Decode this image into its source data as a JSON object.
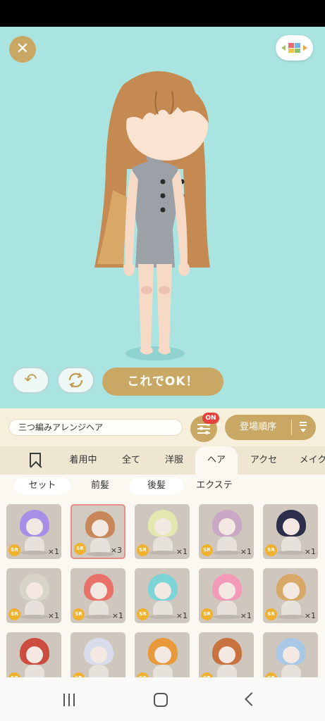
{
  "screen": {
    "ok_button": "これでOK！",
    "close_glyph": "✕",
    "undo_glyph": "↶"
  },
  "toolbar": {
    "item_name": "三つ編みアレンジヘア",
    "filter_badge": "ON",
    "sort_label": "登場順序"
  },
  "categories": [
    "着用中",
    "全て",
    "洋服",
    "ヘア",
    "アクセ",
    "メイク"
  ],
  "active_category": "ヘア",
  "subcategories": [
    "セット",
    "前髪",
    "後髪",
    "エクステ"
  ],
  "active_subcategory": "前髪",
  "items": [
    {
      "rarity": "SR",
      "qty": "×1",
      "color": "#a98ee8"
    },
    {
      "rarity": "SR",
      "qty": "×3",
      "color": "#c8875a",
      "selected": true
    },
    {
      "rarity": "SR",
      "qty": "×1",
      "color": "#e4e8b0"
    },
    {
      "rarity": "SR",
      "qty": "×1",
      "color": "#c9a8c6"
    },
    {
      "rarity": "SR",
      "qty": "×1",
      "color": "#2d2f4a"
    },
    {
      "rarity": "SR",
      "qty": "×1",
      "color": "#d9d4c8"
    },
    {
      "rarity": "SR",
      "qty": "×1",
      "color": "#e8726a"
    },
    {
      "rarity": "SR",
      "qty": "×1",
      "color": "#7cd4d6"
    },
    {
      "rarity": "SR",
      "qty": "×1",
      "color": "#f29ab8"
    },
    {
      "rarity": "SR",
      "qty": "×1",
      "color": "#d8a866"
    },
    {
      "rarity": "SR",
      "qty": "",
      "color": "#cc4d3f"
    },
    {
      "rarity": "SR",
      "qty": "",
      "color": "#d8dcea"
    },
    {
      "rarity": "SR",
      "qty": "",
      "color": "#e89a3a"
    },
    {
      "rarity": "SR",
      "qty": "",
      "color": "#c7723f"
    },
    {
      "rarity": "SR",
      "qty": "",
      "color": "#a8c8e6"
    }
  ],
  "colors": {
    "accent": "#c9a865",
    "stage_background": "#a9e4e1",
    "badge": "#e5423c"
  }
}
